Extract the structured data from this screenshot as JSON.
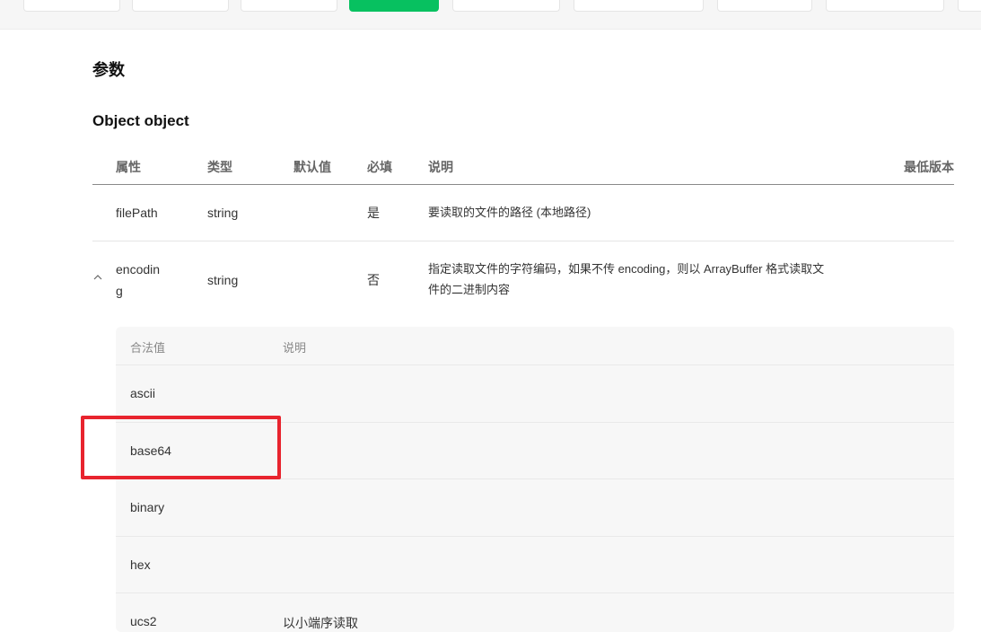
{
  "page": {
    "title": "参数",
    "object_title": "Object object"
  },
  "table": {
    "headers": {
      "property": "属性",
      "type": "类型",
      "default": "默认值",
      "required": "必填",
      "description": "说明",
      "min_version": "最低版本"
    },
    "rows": [
      {
        "property": "filePath",
        "type": "string",
        "default": "",
        "required": "是",
        "description": "要读取的文件的路径 (本地路径)"
      },
      {
        "property_line1": "encodin",
        "property_line2": "g",
        "type": "string",
        "default": "",
        "required": "否",
        "description_line1": "指定读取文件的字符编码，如果不传 encoding，则以 ArrayBuffer 格式读取文",
        "description_line2": "件的二进制内容"
      }
    ]
  },
  "enum_table": {
    "headers": {
      "value": "合法值",
      "description": "说明"
    },
    "rows": [
      {
        "value": "ascii",
        "description": ""
      },
      {
        "value": "base64",
        "description": ""
      },
      {
        "value": "binary",
        "description": ""
      },
      {
        "value": "hex",
        "description": ""
      },
      {
        "value": "ucs2",
        "description": "以小端序读取"
      }
    ]
  },
  "top_tabs": {
    "active_color": "#07c160"
  },
  "highlight": {
    "color": "#e8242e",
    "target": "base64"
  },
  "icons": {
    "expand": "chevron-up-icon"
  }
}
